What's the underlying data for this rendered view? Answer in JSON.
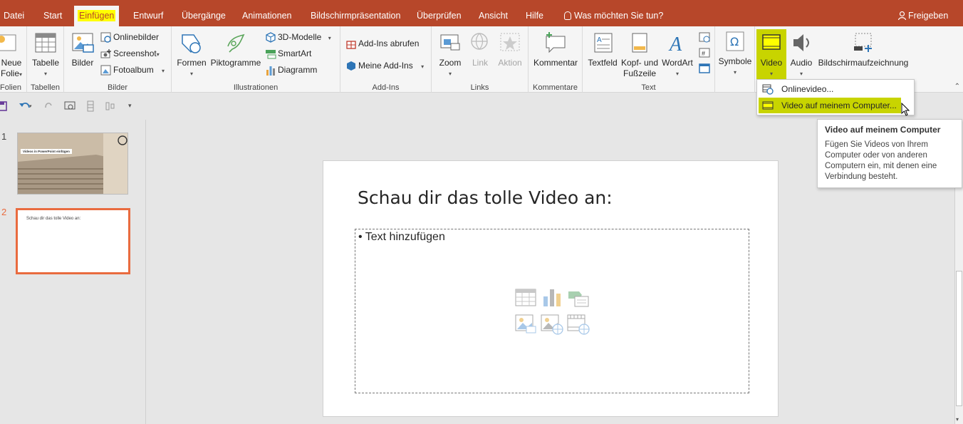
{
  "tabs": [
    "Datei",
    "Start",
    "Einfügen",
    "Entwurf",
    "Übergänge",
    "Animationen",
    "Bildschirmpräsentation",
    "Überprüfen",
    "Ansicht",
    "Hilfe"
  ],
  "active_tab": "Einfügen",
  "search_placeholder": "Was möchten Sie tun?",
  "share_label": "Freigeben",
  "colors": {
    "titlebar": "#b7472a",
    "highlight": "#ffff00",
    "selection_green": "#c8d400",
    "thumb_border": "#e96b3f"
  },
  "ribbon": {
    "folien": {
      "btn1": "Neue",
      "btn2": "Folie",
      "label": "Folien"
    },
    "tabellen": {
      "btn": "Tabelle",
      "label": "Tabellen"
    },
    "bilder": {
      "btn": "Bilder",
      "online": "Onlinebilder",
      "screenshot": "Screenshot",
      "fotoalbum": "Fotoalbum",
      "label": "Bilder"
    },
    "illustrationen": {
      "formen": "Formen",
      "piktogramme": "Piktogramme",
      "modelle": "3D-Modelle",
      "smartart": "SmartArt",
      "diagramm": "Diagramm",
      "label": "Illustrationen"
    },
    "addins": {
      "abrufen": "Add-Ins abrufen",
      "meine": "Meine Add-Ins",
      "label": "Add-Ins"
    },
    "links": {
      "zoom": "Zoom",
      "link": "Link",
      "aktion": "Aktion",
      "label": "Links"
    },
    "kommentare": {
      "kommentar": "Kommentar",
      "label": "Kommentare"
    },
    "text": {
      "textfeld": "Textfeld",
      "kopf1": "Kopf- und",
      "kopf2": "Fußzeile",
      "wordart": "WordArt",
      "label": "Text"
    },
    "symbole": {
      "btn": "Symbole"
    },
    "medien": {
      "video": "Video",
      "audio": "Audio",
      "bildschirm": "Bildschirmaufzeichnung"
    }
  },
  "video_menu": {
    "items": [
      "Onlinevideo...",
      "Video auf meinem Computer..."
    ]
  },
  "tooltip": {
    "title": "Video auf meinem Computer",
    "body": "Fügen Sie Videos von Ihrem Computer oder von anderen Computern ein, mit denen eine Verbindung besteht."
  },
  "slides": [
    {
      "number": "1",
      "text": "Videos in PowerPoint einfügen"
    },
    {
      "number": "2",
      "text": "Schau dir das tolle Video an:"
    }
  ],
  "slide": {
    "title": "Schau dir das tolle Video an:",
    "placeholder": "Text hinzufügen"
  }
}
